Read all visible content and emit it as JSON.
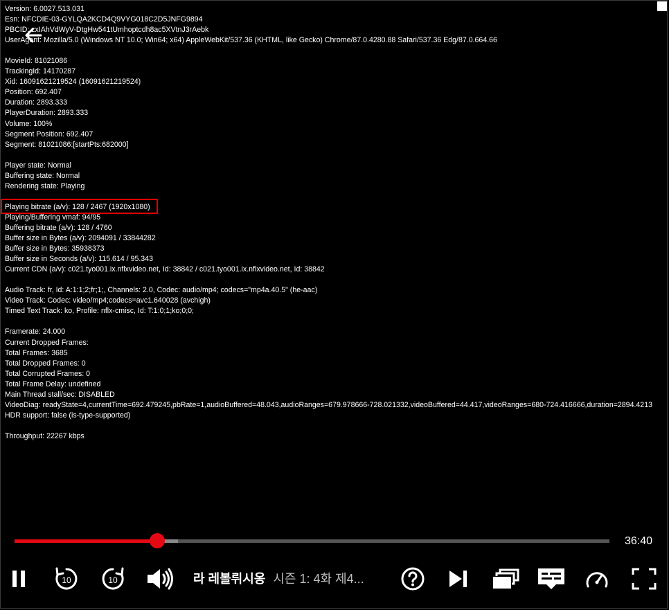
{
  "diagnostics": [
    "Version: 6.0027.513.031",
    "Esn: NFCDIE-03-GYLQA2KCD4Q9VYG018C2D5JNFG9894",
    "PBCID: zxIAhVdWyV-DtgHw541tUmhoptcdh8ac5XVtnJ3rAebk",
    "UserAgent: Mozilla/5.0 (Windows NT 10.0; Win64; x64) AppleWebKit/537.36 (KHTML, like Gecko) Chrome/87.0.4280.88 Safari/537.36 Edg/87.0.664.66",
    "",
    "MovieId: 81021086",
    "TrackingId: 14170287",
    "Xid: 16091621219524 (16091621219524)",
    "Position: 692.407",
    "Duration: 2893.333",
    "PlayerDuration: 2893.333",
    "Volume: 100%",
    "Segment Position: 692.407",
    "Segment: 81021086:[startPts:682000]",
    "",
    "Player state: Normal",
    "Buffering state: Normal",
    "Rendering state: Playing",
    "",
    "Playing bitrate (a/v): 128 / 2467 (1920x1080)",
    "Playing/Buffering vmaf: 94/95",
    "Buffering bitrate (a/v): 128 / 4760",
    "Buffer size in Bytes (a/v): 2094091 / 33844282",
    "Buffer size in Bytes: 35938373",
    "Buffer size in Seconds (a/v): 115.614 / 95.343",
    "Current CDN (a/v): c021.tyo001.ix.nflxvideo.net, Id: 38842 / c021.tyo001.ix.nflxvideo.net, Id: 38842",
    "",
    "Audio Track: fr, Id: A:1:1;2;fr;1;, Channels: 2.0, Codec: audio/mp4; codecs=\"mp4a.40.5\" (he-aac)",
    "Video Track: Codec: video/mp4;codecs=avc1.640028 (avchigh)",
    "Timed Text Track: ko, Profile: nflx-cmisc, Id: T:1:0;1;ko;0;0;",
    "",
    "Framerate: 24.000",
    "Current Dropped Frames:",
    "Total Frames: 3685",
    "Total Dropped Frames: 0",
    "Total Corrupted Frames: 0",
    "Total Frame Delay: undefined",
    "Main Thread stall/sec: DISABLED",
    "VideoDiag: readyState=4,currentTime=692.479245,pbRate=1,audioBuffered=48.043,audioRanges=679.978666-728.021332,videoBuffered=44.417,videoRanges=680-724.416666,duration=2894.4213",
    "HDR support: false (is-type-supported)",
    "",
    "Throughput: 22267 kbps"
  ],
  "player": {
    "progress_played_fraction": 0.24,
    "progress_buffered_fraction": 0.275,
    "time_remaining": "36:40",
    "show_title": "라 레볼뤼시옹",
    "episode_title": "시즌 1: 4화  제4...",
    "accent_color": "#e50914"
  },
  "icons": {
    "back": "back-arrow-icon",
    "pause": "pause-icon",
    "rewind": "rewind-10-icon",
    "forward": "forward-10-icon",
    "volume": "volume-icon",
    "help": "help-icon",
    "next": "next-episode-icon",
    "episodes": "episodes-icon",
    "subtitles": "subtitles-icon",
    "speed": "playback-speed-icon",
    "fullscreen": "fullscreen-icon"
  }
}
